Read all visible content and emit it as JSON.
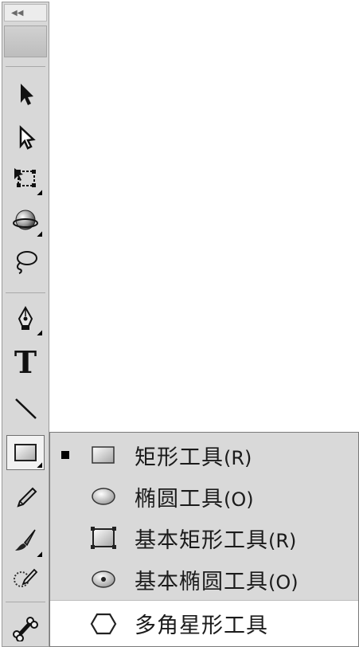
{
  "toolbar": {
    "collapse_glyph": "◀◀",
    "tools": [
      {
        "name": "selection-tool",
        "icon": "arrow-icon"
      },
      {
        "name": "subselection-tool",
        "icon": "hollow-arrow-icon"
      },
      {
        "name": "free-transform-tool",
        "icon": "free-transform-icon"
      },
      {
        "name": "3d-rotation-tool",
        "icon": "sphere-icon"
      },
      {
        "name": "lasso-tool",
        "icon": "lasso-icon"
      },
      {
        "name": "pen-tool",
        "icon": "pen-icon"
      },
      {
        "name": "text-tool",
        "icon": "text-icon",
        "glyph": "T"
      },
      {
        "name": "line-tool",
        "icon": "line-icon"
      },
      {
        "name": "rectangle-tool",
        "icon": "rectangle-icon",
        "active": true
      },
      {
        "name": "pencil-tool",
        "icon": "pencil-icon"
      },
      {
        "name": "brush-tool",
        "icon": "brush-icon"
      },
      {
        "name": "deco-tool",
        "icon": "deco-icon"
      },
      {
        "name": "bone-tool",
        "icon": "bone-icon"
      }
    ]
  },
  "flyout": {
    "items": [
      {
        "label": "矩形工具",
        "shortcut": "(R)",
        "icon": "rectangle-icon",
        "selected": true
      },
      {
        "label": "椭圆工具",
        "shortcut": "(O)",
        "icon": "ellipse-icon"
      },
      {
        "label": "基本矩形工具",
        "shortcut": "(R)",
        "icon": "primitive-rectangle-icon"
      },
      {
        "label": "基本椭圆工具",
        "shortcut": "(O)",
        "icon": "primitive-ellipse-icon"
      },
      {
        "label": "多角星形工具",
        "shortcut": "",
        "icon": "polystar-icon",
        "hovered": true
      }
    ]
  }
}
